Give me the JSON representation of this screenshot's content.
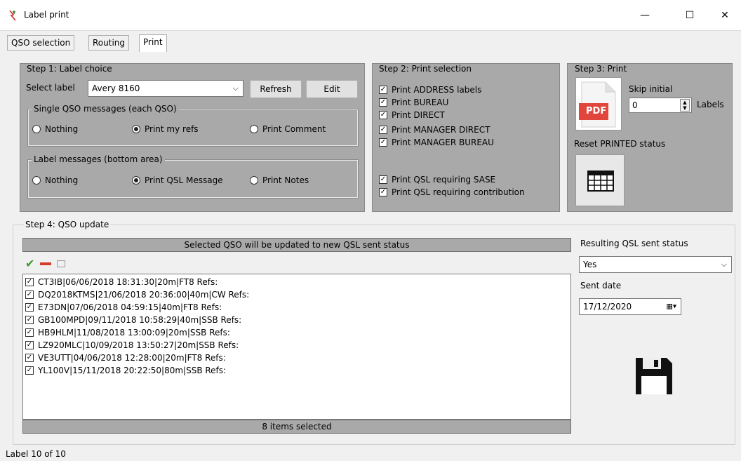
{
  "window": {
    "title": "Label print",
    "minimize": "—",
    "maximize": "☐",
    "close": "✕"
  },
  "tabs": [
    {
      "label": "QSO selection"
    },
    {
      "label": "Routing"
    },
    {
      "label": "Print"
    }
  ],
  "step1": {
    "legend": "Step 1: Label choice",
    "select_label": "Select label",
    "label_value": "Avery 8160",
    "refresh": "Refresh",
    "edit": "Edit",
    "single_group": "Single QSO messages (each QSO)",
    "single_options": [
      {
        "label": "Nothing",
        "selected": false
      },
      {
        "label": "Print my refs",
        "selected": true
      },
      {
        "label": "Print Comment",
        "selected": false
      }
    ],
    "label_group": "Label messages (bottom area)",
    "label_options": [
      {
        "label": "Nothing",
        "selected": false
      },
      {
        "label": "Print QSL Message",
        "selected": true
      },
      {
        "label": "Print Notes",
        "selected": false
      }
    ]
  },
  "step2": {
    "legend": "Step 2: Print selection",
    "checks": [
      {
        "label": "Print ADDRESS labels",
        "checked": true
      },
      {
        "label": "Print BUREAU",
        "checked": true
      },
      {
        "label": "Print DIRECT",
        "checked": true
      },
      {
        "label": "Print MANAGER DIRECT",
        "checked": true
      },
      {
        "label": "Print MANAGER BUREAU",
        "checked": true
      },
      {
        "label": "Print QSL requiring SASE",
        "checked": true
      },
      {
        "label": "Print QSL requiring contribution",
        "checked": true
      }
    ]
  },
  "step3": {
    "legend": "Step 3: Print",
    "pdf_text": "PDF",
    "skip_initial": "Skip initial",
    "skip_value": "0",
    "labels": "Labels",
    "reset": "Reset PRINTED status"
  },
  "step4": {
    "legend": "Step 4: QSO update",
    "header": "Selected QSO will be updated to new QSL sent status",
    "items": [
      "CT3IB|06/06/2018 18:31:30|20m|FT8 Refs:",
      "DQ2018KTMS|21/06/2018 20:36:00|40m|CW Refs:",
      "E73DN|07/06/2018 04:59:15|40m|FT8 Refs:",
      "GB100MPD|09/11/2018 10:58:29|40m|SSB Refs:",
      "HB9HLM|11/08/2018 13:00:09|20m|SSB Refs:",
      "LZ920MLC|10/09/2018 13:50:27|20m|SSB Refs:",
      "VE3UTT|04/06/2018 12:28:00|20m|FT8 Refs:",
      "YL100V|15/11/2018 20:22:50|80m|SSB Refs:"
    ],
    "footer": "8 items selected",
    "resulting_label": "Resulting QSL sent status",
    "resulting_value": "Yes",
    "sent_date_label": "Sent date",
    "sent_date_value": "17/12/2020"
  },
  "status": {
    "text": "Label  10  of  10"
  },
  "colors": {
    "panel": "#a9a9a9",
    "pdf_red": "#e2453b",
    "check_green": "#3a9b2c",
    "remove_red": "#d63a2a"
  }
}
